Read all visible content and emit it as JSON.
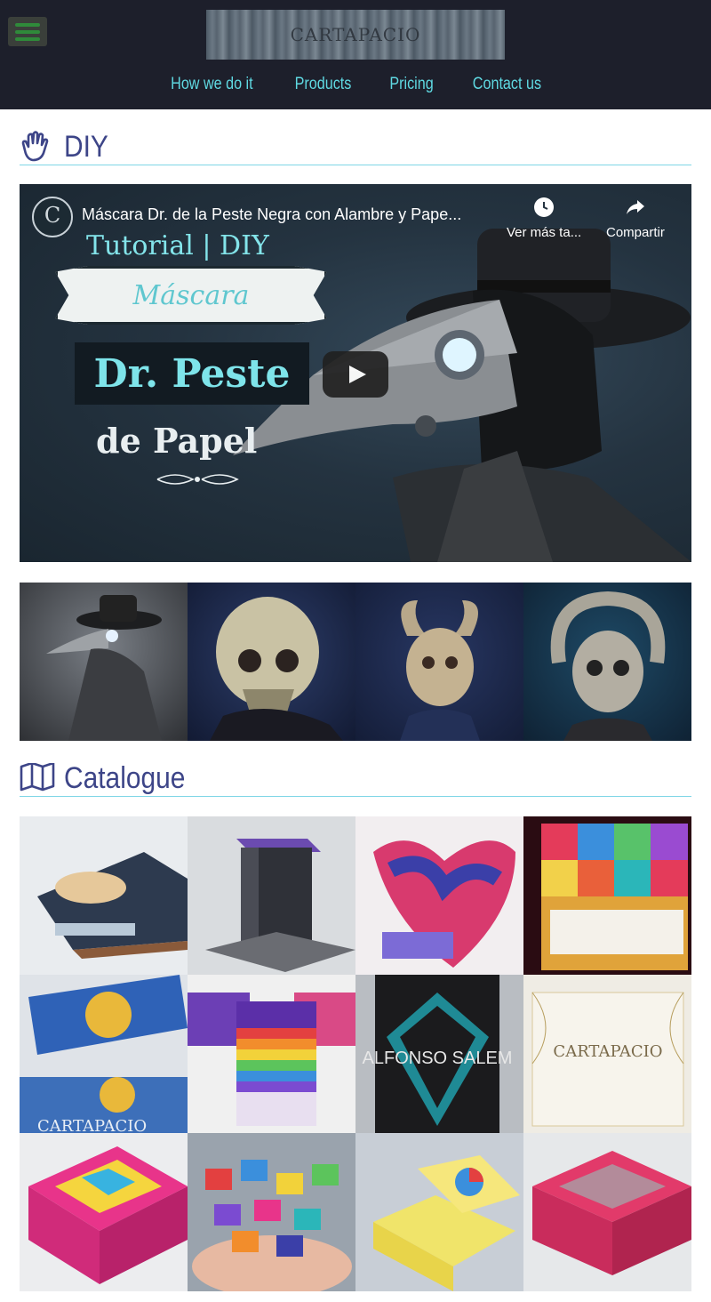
{
  "header": {
    "logo_text": "CARTAPACIO",
    "nav": [
      "How we do it",
      "Products",
      "Pricing",
      "Contact us"
    ]
  },
  "diy": {
    "title": "DIY",
    "video": {
      "channel_logo_letter": "C",
      "title": "Máscara Dr. de la Peste Negra con Alambre y Pape...",
      "watch_later": "Ver más ta...",
      "share": "Compartir",
      "thumb_line1": "Tutorial | DIY",
      "thumb_line2": "Máscara",
      "thumb_line3": "Dr. Peste",
      "thumb_line4": "de Papel"
    },
    "gallery": [
      "plague-doctor-mask",
      "skull-mask",
      "horned-demon-mask",
      "ram-skull-mask"
    ]
  },
  "catalogue": {
    "title": "Catalogue",
    "items": [
      "jon-y-roy-album",
      "gray-box",
      "painted-heart-book",
      "geometric-cube-notebook",
      "sun-moon-book",
      "rainbow-notebooks",
      "alfonso-salem-book",
      "cartapacio-invitation",
      "pink-cube-box",
      "mini-notebooks",
      "yellow-color-wheel-box",
      "pink-window-box"
    ],
    "cartapacio_text": "CARTAPACIO",
    "alfonso_text": "ALFONSO SALEM"
  },
  "colors": {
    "header_bg": "#1d1f2b",
    "nav_link": "#5fd9e2",
    "section_title": "#3d4588",
    "section_rule": "#7fd6e6"
  }
}
